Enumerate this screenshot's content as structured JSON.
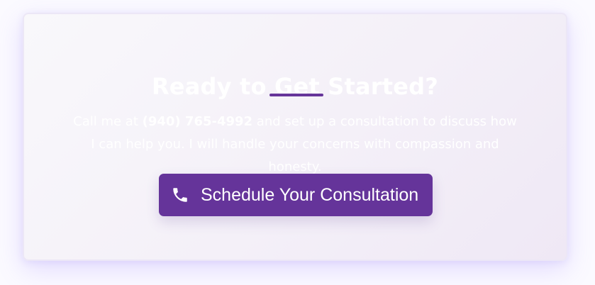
{
  "cta": {
    "title": "Ready to Get Started?",
    "text_before": "Call me at ",
    "phone": "(940) 765-4992",
    "text_after": " and set up a consultation to discuss how I can help you. I will handle your concerns with compassion and honesty.",
    "button_label": "Schedule Your Consultation",
    "button_icon": "phone-icon"
  },
  "colors": {
    "accent": "#65349a",
    "card_background": "#f6f3f9",
    "glow": "#c9b9ff",
    "text": "#ffffff"
  }
}
